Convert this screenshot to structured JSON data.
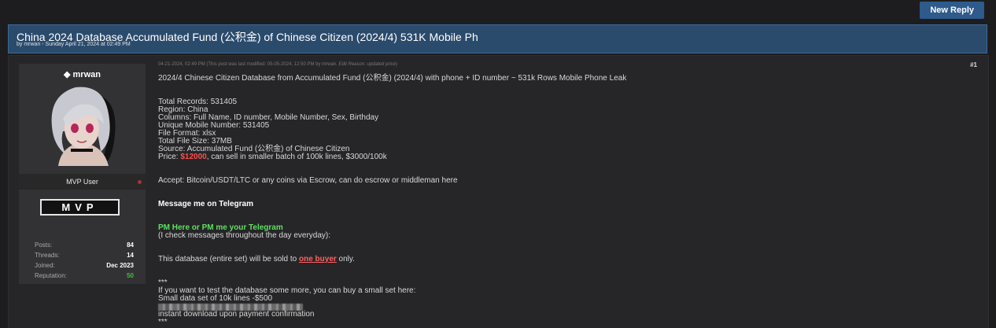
{
  "toolbar": {
    "new_reply_label": "New Reply"
  },
  "thread": {
    "title": "China 2024 Database Accumulated Fund (公积金) of Chinese Citizen (2024/4) 531K Mobile Ph",
    "byline": "by mrwan - Sunday April 21, 2024 at 02:49 PM"
  },
  "author": {
    "username": "mrwan",
    "user_title": "MVP User",
    "badge_text": "MVP",
    "stats": [
      {
        "label": "Posts:",
        "value": "84"
      },
      {
        "label": "Threads:",
        "value": "14"
      },
      {
        "label": "Joined:",
        "value": "Dec 2023"
      },
      {
        "label": "Reputation:",
        "value": "50"
      }
    ],
    "reputation_color": "#3fbf3f",
    "status": "offline"
  },
  "post": {
    "date": "04-21-2024, 02:49 PM",
    "edit_note_prefix": "(This post was last modified: 05-05-2024, 12:50 PM by mrwan.",
    "edit_reason": "Edit Reason: updated price",
    "edit_note_suffix": ")",
    "number": "#1",
    "headline": "2024/4 Chinese Citizen Database from Accumulated Fund (公积金) (2024/4) with phone + ID number ~ 531k Rows Mobile Phone Leak",
    "details": [
      "Total Records: 531405",
      "Region: China",
      "Columns: Full Name, ID number, Mobile Number, Sex, Birthday",
      "Unique Mobile Number: 531405",
      "File Format: xlsx",
      "Total File Size: 37MB",
      "Source: Accumulated Fund (公积金) of Chinese Citizen"
    ],
    "price_label": "Price: ",
    "price_value": "$12000",
    "price_rest": ", can sell in smaller batch of 100k lines, $3000/100k",
    "accept": "Accept: Bitcoin/USDT/LTC or any coins via Escrow, can do escrow or middleman here",
    "message_me": "Message me on Telegram",
    "pm_line": "PM Here or PM me your Telegram",
    "check_messages": "(I check messages throughout the day everyday):",
    "sold_prefix": "This database (entire set) will be sold to ",
    "sold_highlight": "one buyer",
    "sold_suffix": " only.",
    "separator": "***",
    "test_line": "If you want to test the database some more, you can buy a small set here:",
    "small_set": "Small data set of 10k lines -$500",
    "instant": "instant download upon payment confirmation",
    "separator2": "***"
  }
}
